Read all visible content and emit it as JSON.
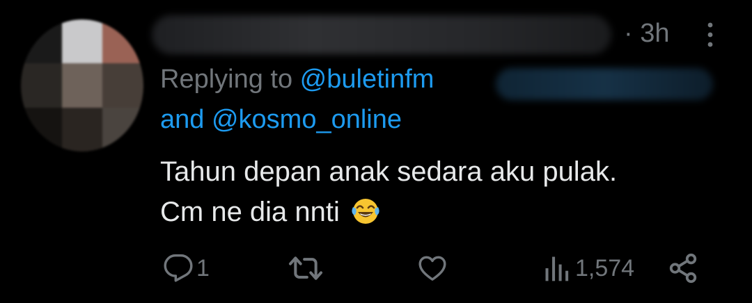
{
  "tweet": {
    "time": "· 3h",
    "replying_prefix": "Replying to ",
    "mention_1": "@buletinfm",
    "mention_and": "and ",
    "mention_2": "@kosmo_online",
    "text_line_1": "Tahun depan anak sedara aku pulak.",
    "text_line_2": "Cm ne dia nnti",
    "emoji": "face-with-tears-of-joy"
  },
  "actions": {
    "reply_count": "1",
    "retweet_count": "",
    "like_count": "",
    "views_count": "1,574"
  },
  "colors": {
    "background": "#000000",
    "text": "#e7e9ea",
    "muted": "#71767b",
    "accent": "#1d9bf0"
  }
}
